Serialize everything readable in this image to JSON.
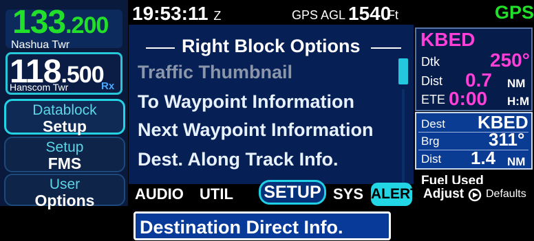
{
  "radio": {
    "active_freq_main": "133",
    "active_freq_sub": ".200",
    "active_name": "Nashua Twr",
    "standby_freq_main": "118",
    "standby_freq_sub": ".500",
    "standby_name": "Hanscom Twr",
    "rx_badge": "Rx"
  },
  "left_buttons": [
    {
      "line1": "Datablock",
      "line2": "Setup"
    },
    {
      "line1": "Setup",
      "line2": "FMS"
    },
    {
      "line1": "User",
      "line2": "Options"
    }
  ],
  "top_bar": {
    "time": "19:53:11",
    "time_zone": "Z",
    "gps_agl_label": "GPS AGL",
    "agl_value": "1540",
    "agl_unit": "Ft",
    "nav_source": "GPS"
  },
  "panel": {
    "title": "Right Block Options",
    "items": [
      "Traffic Thumbnail",
      "To Waypoint Information",
      "Next Waypoint Information",
      "Dest. Along Track Info.",
      "Destination Direct Info."
    ],
    "selected_index": 4
  },
  "right_block": {
    "to_waypoint": "KBED",
    "dtk_label": "Dtk",
    "dtk_value": "250°",
    "dist_label": "Dist",
    "dist_value": "0.7",
    "dist_unit": "NM",
    "ete_label": "ETE",
    "ete_value": "0:00",
    "ete_unit": "H:M",
    "dest_label": "Dest",
    "dest_value": "KBED",
    "brg_label": "Brg",
    "brg_value": "311°",
    "dest_dist_label": "Dist",
    "dest_dist_value": "1.4",
    "dest_dist_unit": "NM",
    "fuel_used_label": "Fuel Used"
  },
  "bottom_tabs": {
    "audio": "AUDIO",
    "util": "UTIL",
    "setup": "SETUP",
    "sys": "SYS",
    "alert": "ALERT",
    "adjust": "Adjust",
    "defaults": "Defaults"
  },
  "colors": {
    "active_green": "#22e02a",
    "magenta": "#ff3fd8",
    "cyan": "#23d3e4",
    "panel_blue": "#062056"
  },
  "icons": {
    "knob": "knob-icon"
  }
}
